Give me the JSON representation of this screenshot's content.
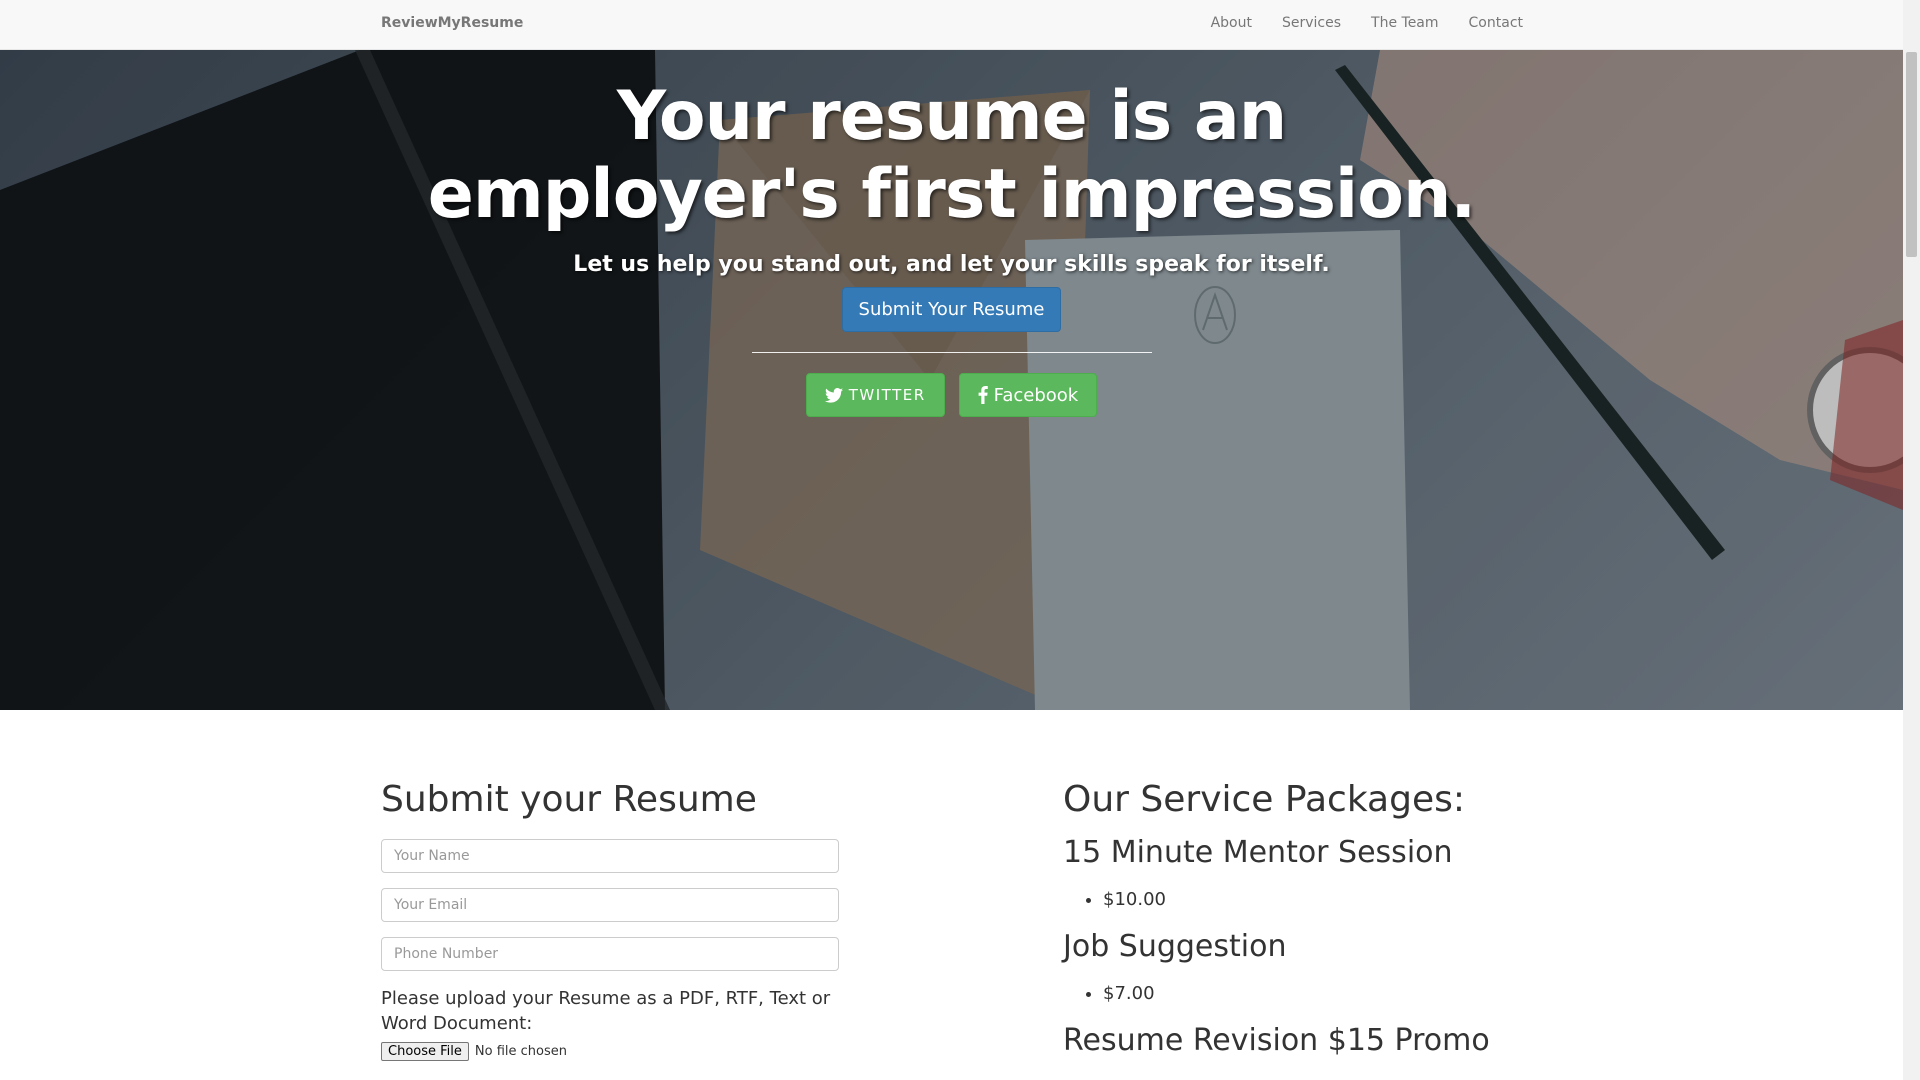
{
  "navbar": {
    "brand": "ReviewMyResume",
    "links": [
      "About",
      "Services",
      "The Team",
      "Contact"
    ]
  },
  "hero": {
    "headline": "Your resume is an employer's first impression.",
    "tagline": "Let us help you stand out, and let your skills speak for itself.",
    "cta_label": "Submit Your Resume",
    "twitter_label": "TWITTER",
    "facebook_label": "Facebook"
  },
  "form": {
    "title": "Submit your Resume",
    "name_placeholder": "Your Name",
    "email_placeholder": "Your Email",
    "phone_placeholder": "Phone Number",
    "upload_label": "Please upload your Resume as a PDF, RTF, Text or Word Document:",
    "file_button": "Choose File",
    "file_status": "No file chosen"
  },
  "packages": {
    "title": "Our Service Packages:",
    "items": [
      {
        "name": "15 Minute Mentor Session",
        "price": "$10.00"
      },
      {
        "name": "Job Suggestion",
        "price": "$7.00"
      },
      {
        "name": "Resume Revision $15 Promo",
        "price": ""
      }
    ]
  },
  "colors": {
    "primary": "#337ab7",
    "success": "#5cb85c",
    "navbar_bg": "#f8f8f8"
  },
  "icons": [
    "twitter-icon",
    "facebook-icon"
  ]
}
